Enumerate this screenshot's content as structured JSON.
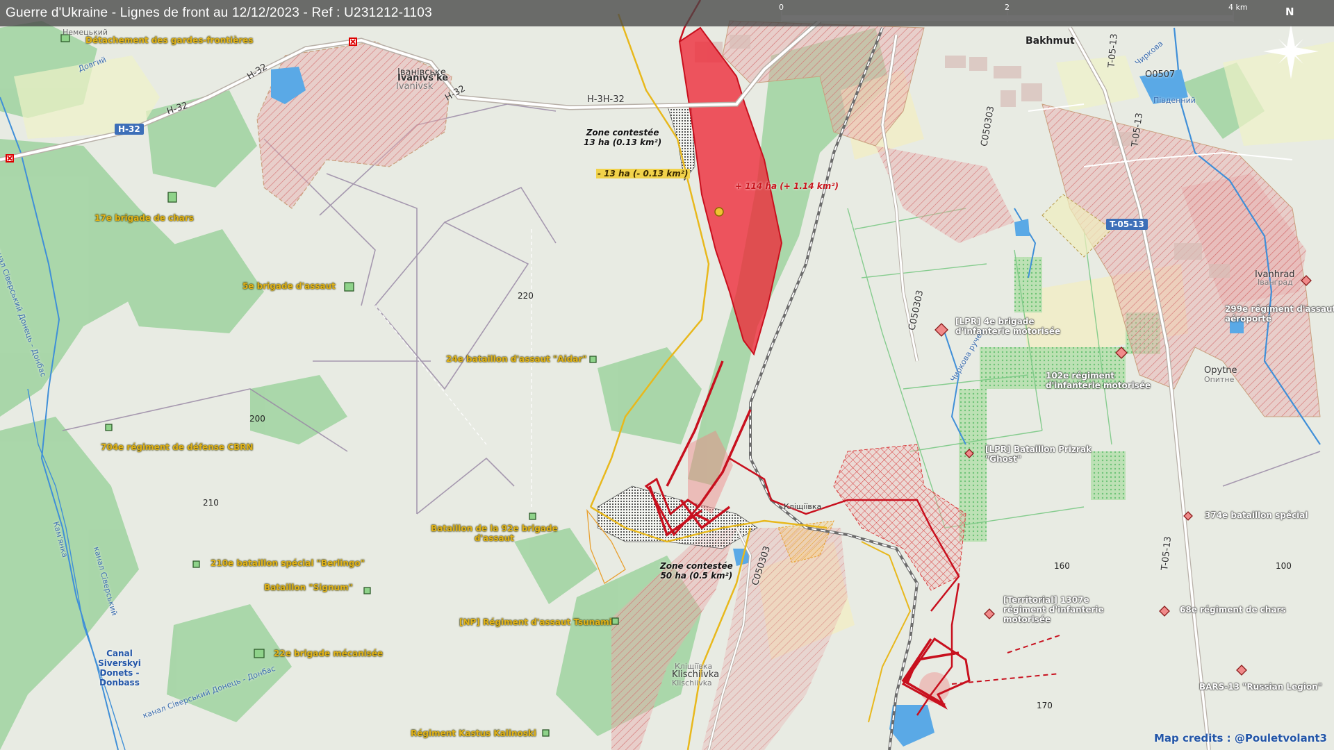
{
  "title": "Guerre d'Ukraine - Lignes de front au 12/12/2023 - Ref : U231212-1103",
  "credit": "Map credits : @Pouletvolant3",
  "scale": {
    "labels": [
      "0",
      "2",
      "4 km"
    ]
  },
  "north": "N",
  "colors": {
    "russian_gain": "#e8192c",
    "ukrainian_unit": "#e1b21a",
    "contested": "#333333",
    "russian_occupied": "#d9a0a0",
    "frontline_ua": "#e8b81c",
    "frontline_ru": "#c8101e",
    "water": "#5aa9e6",
    "forest": "#98cf9a"
  },
  "roads": {
    "h32_shield": "H-32",
    "t0513_shield": "T-05-13",
    "h32_a": "H-32",
    "h32_b": "H-32",
    "h32_c": "H-32",
    "h3h32": "H-3H-32",
    "c050303_a": "C050303",
    "c050303_b": "C050303",
    "c050303_c": "C050303",
    "t0513_a": "T-05-13",
    "t0513_b": "T-05-13",
    "t0513_c": "T-05-13",
    "o0507": "O0507"
  },
  "places": {
    "bakhmut": "Bakhmut",
    "ivanivske": "Ivanivs'ke",
    "ivanivske_ua": "Іванівське",
    "ivanivske_b": "Ivanivsk",
    "ivanhrad": "Ivanhrad",
    "ivanhrad_ua": "Іванград",
    "opytne": "Opytne",
    "opytne_ua": "Опитне",
    "klischiivka": "Klischiivka",
    "klischiivka_ua": "Кліщіївка",
    "klischiivka_b": "Klischiivka",
    "klischiivka_mid": "Кліщіївка",
    "nemetsky": "Немецький",
    "dovhyi": "Довгий",
    "pivdennyi": "Південний",
    "chyrkova": "Чиркова",
    "chyrkiv_ruchei": "Чиркова ручей",
    "kanal_ua": "канал Сіверський Донець - Донбас",
    "kanal_ua2": "канал Сіверський Донець - Донбас",
    "kanal_ua3": "канал Сіверський",
    "canal": "Canal Siverskyi Donets - Donbass",
    "kamyanka": "Кам'янка"
  },
  "elevations": [
    "220",
    "200",
    "210",
    "160",
    "100",
    "170"
  ],
  "zones": {
    "contested_top": "Zone contestée\n13 ha (0.13 km²)",
    "contested_bottom": "Zone contestée\n50 ha (0.5 km²)",
    "gain": "+ 114 ha (+ 1.14 km²)",
    "loss": "- 13 ha (- 0.13 km²)"
  },
  "ua_units": [
    "Détachement des gardes-frontières",
    "17e brigade de chars",
    "5e brigade d'assaut",
    "24e bataillon d'assaut \"Aidar\"",
    "704e régiment de défense CBRN",
    "Bataillon de la 92e brigade\nd'assaut",
    "210e bataillon spécial \"Berlingo\"",
    "Bataillon \"Signum\"",
    "[NP] Régiment d'assaut Tsunami",
    "22e brigade mécanisée",
    "Régiment Kastus Kalinoski"
  ],
  "ru_units": [
    "[LPR] 4e brigade\nd'infanterie motorisée",
    "102e régiment\nd'infanterie motorisée",
    "[LPR] Bataillon Prizrak\n\"Ghost\"",
    "[Territorial] 1307e\nrégiment d'infanterie\nmotorisée",
    "299e régiment d'assaut\naéroporté",
    "374e bataillon spécial",
    "68e régiment de chars",
    "BARS-13 \"Russian Legion\""
  ]
}
